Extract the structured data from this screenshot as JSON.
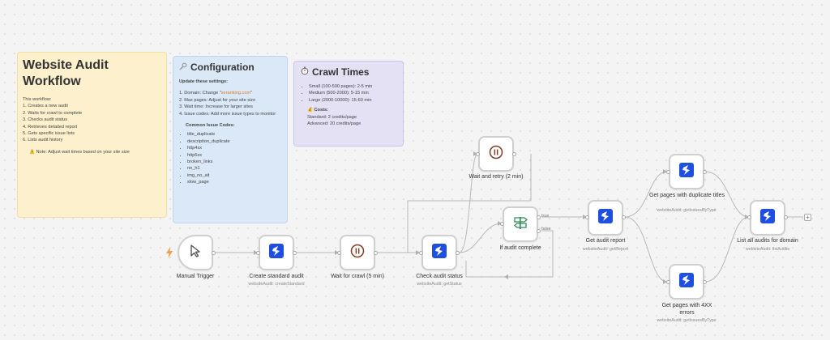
{
  "notes": {
    "overview": {
      "title": "Website Audit Workflow",
      "intro": "This workflow:",
      "steps": [
        "1. Creates a new audit",
        "2. Waits for crawl to complete",
        "3. Checks audit status",
        "4. Retrieves detailed report",
        "5. Gets specific issue lists",
        "6. Lists audit history"
      ],
      "note": "⚠️ Note: Adjust wait times based on your site size"
    },
    "config": {
      "title": "Configuration",
      "icon": "wrench-icon",
      "update_heading": "Update these settings:",
      "setting_1_prefix": "1. Domain: Change \"",
      "setting_1_domain": "seranking.com",
      "setting_1_suffix": "\"",
      "settings_rest": [
        "2. Max pages: Adjust for your site size",
        "3. Wait time: Increase for larger sites",
        "4. Issue codes: Add more issue types to monitor"
      ],
      "codes_heading": "Common Issue Codes:",
      "codes": [
        "title_duplicate",
        "description_duplicate",
        "http4xx",
        "http5xx",
        "broken_links",
        "no_h1",
        "img_no_alt",
        "slow_page"
      ]
    },
    "crawl": {
      "title": "Crawl Times",
      "icon": "stopwatch-icon",
      "times": [
        "Small (100-500 pages): 2-5 min",
        "Medium (500-2000): 5-15 min",
        "Large (2000-10000): 15-60 min"
      ],
      "costs_heading": "💰 Costs:",
      "costs": [
        "Standard: 2 credits/page",
        "Advanced: 20 credits/page"
      ]
    }
  },
  "nodes": {
    "manual_trigger": {
      "label": "Manual Trigger",
      "icon": "cursor-icon"
    },
    "create_audit": {
      "label": "Create standard audit",
      "sub": "websiteAudit: createStandard",
      "icon": "seranking-icon"
    },
    "wait_crawl": {
      "label": "Wait for crawl (5 min)",
      "icon": "pause-icon"
    },
    "check_status": {
      "label": "Check audit status",
      "sub": "websiteAudit: getStatus",
      "icon": "seranking-icon"
    },
    "wait_retry": {
      "label": "Wait and retry (2 min)",
      "icon": "pause-icon"
    },
    "if_complete": {
      "label": "If audit complete",
      "icon": "signpost-icon",
      "true_label": "true",
      "false_label": "false"
    },
    "get_report": {
      "label": "Get audit report",
      "sub": "websiteAudit: getReport",
      "icon": "seranking-icon"
    },
    "dup_titles": {
      "label": "Get pages with duplicate titles",
      "sub": "websiteAudit: getIssuesByType",
      "icon": "seranking-icon"
    },
    "errors_4xx": {
      "label": "Get pages with 4XX errors",
      "sub": "websiteAudit: getIssuesByType",
      "icon": "seranking-icon"
    },
    "list_audits": {
      "label": "List all audits for domain",
      "sub": "websiteAudit: listAudits",
      "icon": "seranking-icon"
    }
  },
  "colors": {
    "seranking_blue": "#1e4fe0",
    "pause_ring": "#7a3e2a",
    "signpost_green": "#2e8b57",
    "canvas": "#f4f4f4"
  },
  "add_button": "+"
}
